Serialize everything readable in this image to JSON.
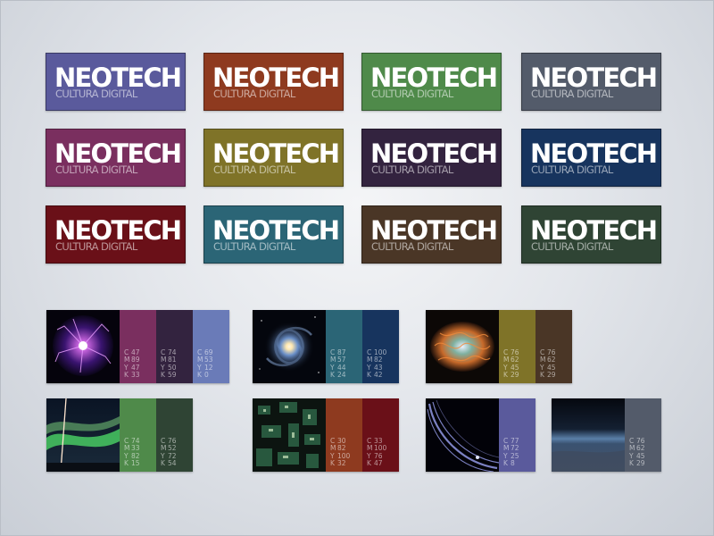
{
  "logos": {
    "brand": "NEOTECH",
    "tagline": "CULTURA DIGITAL",
    "colors": [
      "#5a5a9c",
      "#8e3a1f",
      "#4f8a4a",
      "#535b6a",
      "#7a2f5f",
      "#7f7328",
      "#33233f",
      "#17345e",
      "#6a1018",
      "#2b6576",
      "#4a3626",
      "#2f4434"
    ]
  },
  "palettes": [
    {
      "photo": "plasma-ball-photo",
      "swatches": [
        {
          "color": "#7a2f5f",
          "c": "47",
          "m": "89",
          "y": "47",
          "k": "33"
        },
        {
          "color": "#33233f",
          "c": "74",
          "m": "81",
          "y": "50",
          "k": "59"
        },
        {
          "color": "#6a7bb8",
          "c": "69",
          "m": "53",
          "y": "12",
          "k": "0"
        }
      ]
    },
    {
      "photo": "spiral-galaxy-photo",
      "swatches": [
        {
          "color": "#2b6576",
          "c": "87",
          "m": "57",
          "y": "44",
          "k": "24"
        },
        {
          "color": "#17345e",
          "c": "100",
          "m": "82",
          "y": "43",
          "k": "42"
        }
      ]
    },
    {
      "photo": "crab-nebula-photo",
      "swatches": [
        {
          "color": "#7f7328",
          "c": "76",
          "m": "62",
          "y": "45",
          "k": "29"
        },
        {
          "color": "#4a3626",
          "c": "76",
          "m": "62",
          "y": "45",
          "k": "29"
        }
      ]
    },
    {
      "photo": "aurora-photo",
      "swatches": [
        {
          "color": "#4f8a4a",
          "c": "74",
          "m": "33",
          "y": "82",
          "k": "15"
        },
        {
          "color": "#2f4434",
          "c": "76",
          "m": "52",
          "y": "72",
          "k": "54"
        }
      ]
    },
    {
      "photo": "circuit-city-photo",
      "swatches": [
        {
          "color": "#8e3a1f",
          "c": "30",
          "m": "82",
          "y": "100",
          "k": "32"
        },
        {
          "color": "#6a1018",
          "c": "33",
          "m": "100",
          "y": "76",
          "k": "47"
        }
      ]
    },
    {
      "photo": "planet-rings-photo",
      "swatches": [
        {
          "color": "#5a5a9c",
          "c": "77",
          "m": "72",
          "y": "25",
          "k": "8"
        }
      ]
    },
    {
      "photo": "earth-horizon-photo",
      "swatches": [
        {
          "color": "#535b6a",
          "c": "76",
          "m": "62",
          "y": "45",
          "k": "29"
        }
      ]
    }
  ]
}
